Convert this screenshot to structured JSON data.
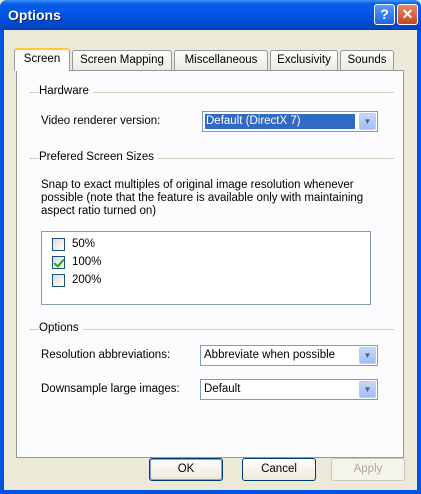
{
  "window": {
    "title": "Options"
  },
  "tabs": [
    {
      "label": "Screen"
    },
    {
      "label": "Screen Mapping"
    },
    {
      "label": "Miscellaneous"
    },
    {
      "label": "Exclusivity"
    },
    {
      "label": "Sounds"
    }
  ],
  "hardware": {
    "group_label": "Hardware",
    "renderer_label": "Video renderer version:",
    "renderer_value": "Default (DirectX 7)"
  },
  "screen_sizes": {
    "group_label": "Prefered Screen Sizes",
    "description_lines": [
      "Snap to exact multiples of original image resolution whenever",
      "possible (note that the feature is available only with maintaining",
      "aspect ratio turned on)"
    ],
    "options": [
      {
        "label": "50%",
        "checked": false
      },
      {
        "label": "100%",
        "checked": true
      },
      {
        "label": "200%",
        "checked": false
      }
    ]
  },
  "options_group": {
    "group_label": "Options",
    "abbrev_label": "Resolution abbreviations:",
    "abbrev_value": "Abbreviate when possible",
    "downsample_label": "Downsample large images:",
    "downsample_value": "Default"
  },
  "buttons": {
    "ok": "OK",
    "cancel": "Cancel",
    "apply": "Apply"
  }
}
